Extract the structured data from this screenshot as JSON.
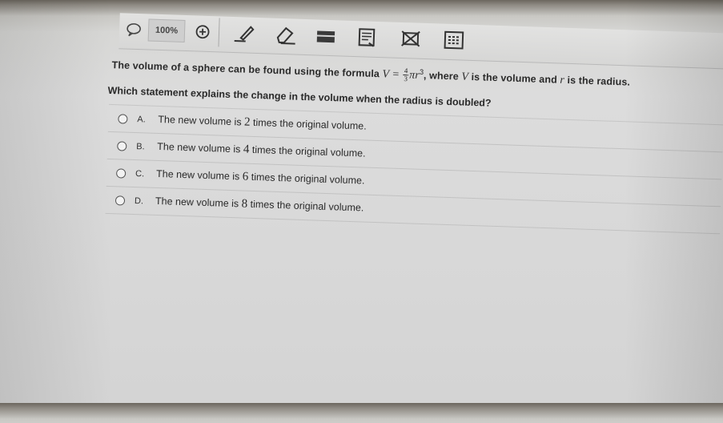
{
  "toolbar": {
    "zoom_label": "100%",
    "tools": [
      {
        "icon": "comment-icon"
      },
      {
        "icon": "zoom-in-icon"
      },
      {
        "icon": "pencil-icon"
      },
      {
        "icon": "eraser-icon"
      },
      {
        "icon": "highlighter-icon"
      },
      {
        "icon": "notepad-icon"
      },
      {
        "icon": "eliminate-icon"
      },
      {
        "icon": "calculator-icon"
      }
    ]
  },
  "question": {
    "stem_before": "The volume of a sphere can be found using the formula",
    "formula_var": "V =",
    "frac_num": "4",
    "frac_den": "3",
    "formula_tail": "πr",
    "formula_exp": "3",
    "stem_after_1": ", where",
    "stem_var_v": "V",
    "stem_after_2": "is the volume and",
    "stem_var_r": "r",
    "stem_after_3": "is the radius.",
    "prompt": "Which statement explains the change in the volume when the radius is doubled?"
  },
  "options": [
    {
      "letter": "A.",
      "before": "The new volume is",
      "num": "2",
      "after": "times the original volume."
    },
    {
      "letter": "B.",
      "before": "The new volume is",
      "num": "4",
      "after": "times the original volume."
    },
    {
      "letter": "C.",
      "before": "The new volume is",
      "num": "6",
      "after": "times the original volume."
    },
    {
      "letter": "D.",
      "before": "The new volume is",
      "num": "8",
      "after": "times the original volume."
    }
  ]
}
